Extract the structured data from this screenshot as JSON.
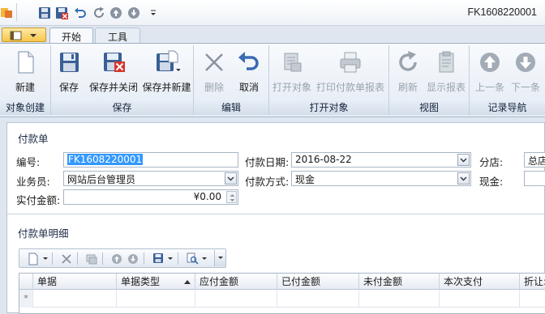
{
  "window": {
    "title": "FK1608220001"
  },
  "tabs": [
    {
      "label": "开始"
    },
    {
      "label": "工具"
    }
  ],
  "ribbon": {
    "groups": [
      {
        "label": "对象创建",
        "buttons": [
          {
            "label": "新建"
          }
        ]
      },
      {
        "label": "保存",
        "buttons": [
          {
            "label": "保存"
          },
          {
            "label": "保存并关闭"
          },
          {
            "label": "保存并新建"
          }
        ]
      },
      {
        "label": "编辑",
        "buttons": [
          {
            "label": "删除"
          },
          {
            "label": "取消"
          }
        ]
      },
      {
        "label": "打开对象",
        "buttons": [
          {
            "label": "打开对象"
          },
          {
            "label": "打印付款单报表"
          }
        ]
      },
      {
        "label": "视图",
        "buttons": [
          {
            "label": "刷新"
          },
          {
            "label": "显示报表"
          }
        ]
      },
      {
        "label": "记录导航",
        "buttons": [
          {
            "label": "上一条"
          },
          {
            "label": "下一条"
          }
        ]
      }
    ]
  },
  "form": {
    "section_title": "付款单",
    "number": {
      "label": "编号:",
      "value": "FK1608220001"
    },
    "pay_date": {
      "label": "付款日期:",
      "value": "2016-08-22"
    },
    "branch": {
      "label": "分店:",
      "value": "总店"
    },
    "salesman": {
      "label": "业务员:",
      "value": "网站后台管理员"
    },
    "pay_method": {
      "label": "付款方式:",
      "value": "现金"
    },
    "cash": {
      "label": "现金:",
      "value": ""
    },
    "actual_amount": {
      "label": "实付金额:",
      "value": "¥0.00"
    }
  },
  "detail": {
    "section_title": "付款单明细",
    "columns": [
      "单据",
      "单据类型",
      "应付金额",
      "已付金额",
      "未付金额",
      "本次支付",
      "折让:"
    ],
    "new_row_marker": "*"
  },
  "colors": {
    "accent": "#3c6fb0",
    "selection": "#3399ff",
    "disabled": "#9aa3ad"
  }
}
